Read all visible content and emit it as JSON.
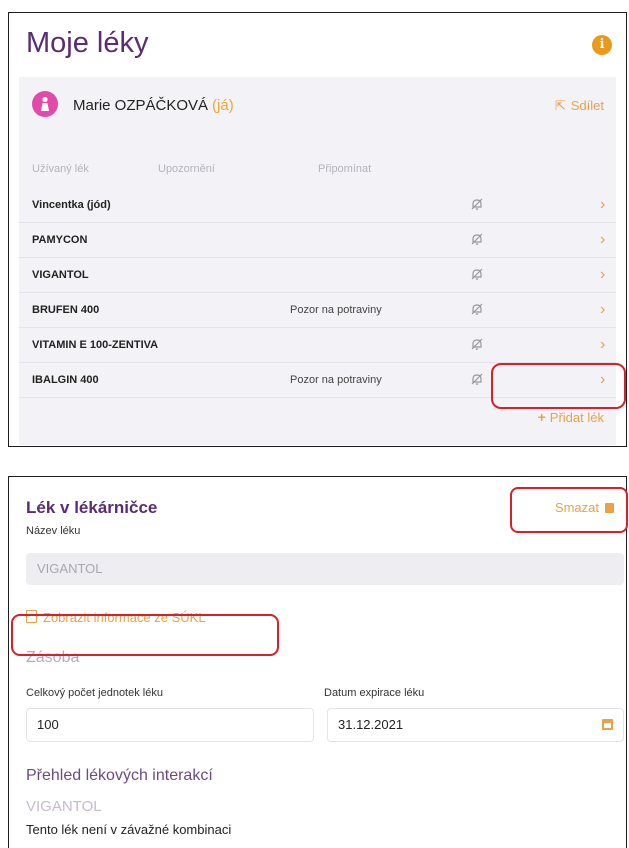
{
  "my_meds": {
    "title": "Moje léky",
    "user": {
      "name": "Marie OZPÁČKOVÁ",
      "tag": "(já)"
    },
    "share_label": "Sdílet",
    "columns": [
      "Užívaný lék",
      "Upozornění",
      "Připomínat"
    ],
    "rows": [
      {
        "name": "Vincentka (jód)",
        "warning": ""
      },
      {
        "name": "PAMYCON",
        "warning": ""
      },
      {
        "name": "VIGANTOL",
        "warning": ""
      },
      {
        "name": "BRUFEN 400",
        "warning": "Pozor na potraviny"
      },
      {
        "name": "VITAMIN E 100-ZENTIVA",
        "warning": ""
      },
      {
        "name": "IBALGIN 400",
        "warning": "Pozor na potraviny"
      }
    ],
    "add_label": "Přidat lék"
  },
  "detail": {
    "title": "Lék v lékárničce",
    "delete_label": "Smazat",
    "name_label": "Název léku",
    "name_value": "VIGANTOL",
    "sukl_link": "Zobrazit informace ze SÚKL",
    "stock_heading": "Zásoba",
    "count_label": "Celkový počet jednotek léku",
    "count_value": "100",
    "expiry_label": "Datum expirace léku",
    "expiry_value": "31.12.2021",
    "interactions_heading": "Přehled lékových interakcí",
    "interaction_drug": "VIGANTOL",
    "interaction_text": "Tento lék není v závažné kombinaci"
  },
  "colors": {
    "primary": "#5a2c73",
    "accent": "#e9a24a",
    "highlight": "#d6202a",
    "avatar": "#e24aaa"
  }
}
